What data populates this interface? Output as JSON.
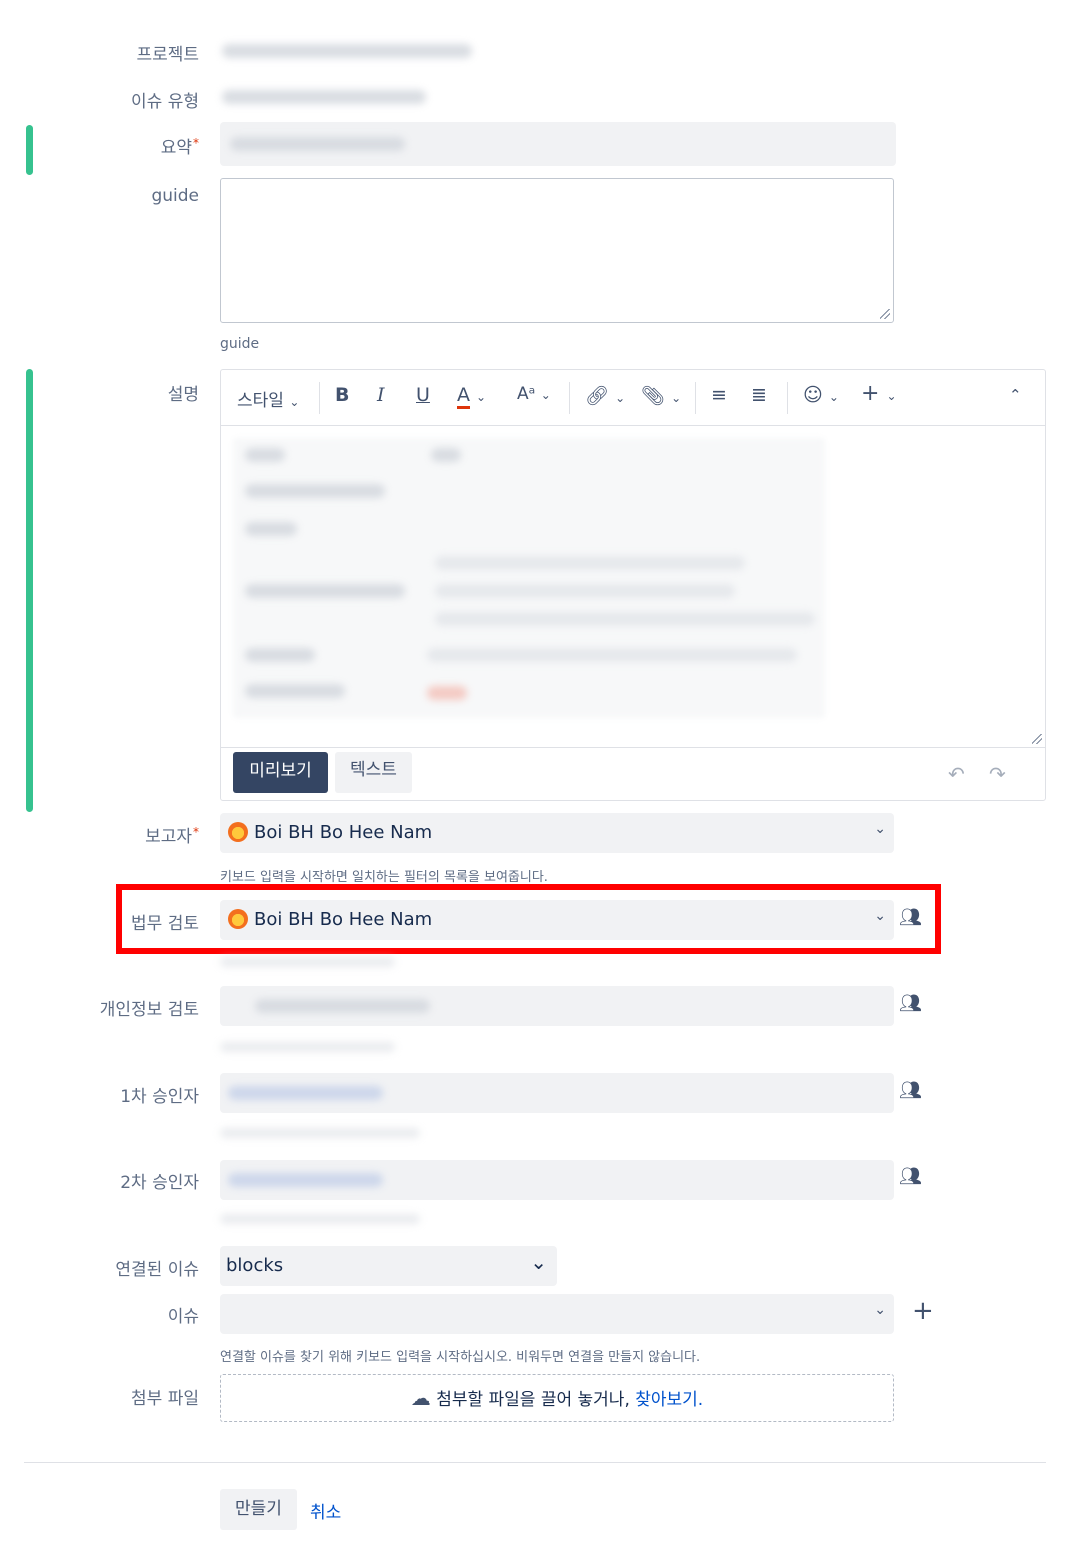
{
  "labels": {
    "project": "프로젝트",
    "issue_type": "이슈 유형",
    "summary": "요약",
    "guide": "guide",
    "description": "설명",
    "reporter": "보고자",
    "legal_review": "법무 검토",
    "privacy_review": "개인정보 검토",
    "approver1": "1차 승인자",
    "approver2": "2차 승인자",
    "linked_issues": "연결된 이슈",
    "issue": "이슈",
    "attachment": "첨부 파일"
  },
  "required_marker": "*",
  "guide_help": "guide",
  "toolbar": {
    "style": "스타일",
    "bold": "B",
    "italic": "I",
    "underline": "U",
    "text_color": "A"
  },
  "editor_tabs": {
    "preview": "미리보기",
    "text": "텍스트"
  },
  "reporter": {
    "value": "Boi BH Bo Hee Nam",
    "hint": "키보드 입력을 시작하면 일치하는 필터의 목록을 보여줍니다."
  },
  "legal_review": {
    "value": "Boi BH Bo Hee Nam"
  },
  "linked_issues": {
    "value": "blocks"
  },
  "issue": {
    "hint": "연결할 이슈를 찾기 위해 키보드 입력을 시작하십시오. 비워두면 연결을 만들지 않습니다."
  },
  "attachment": {
    "text": "첨부할 파일을 끌어 놓거나,",
    "link": "찾아보기."
  },
  "footer": {
    "create": "만들기",
    "cancel": "취소"
  },
  "colors": {
    "accent_green": "#36c28f",
    "highlight_red": "#ff0000",
    "link_blue": "#0052cc",
    "dark_button": "#344563"
  }
}
